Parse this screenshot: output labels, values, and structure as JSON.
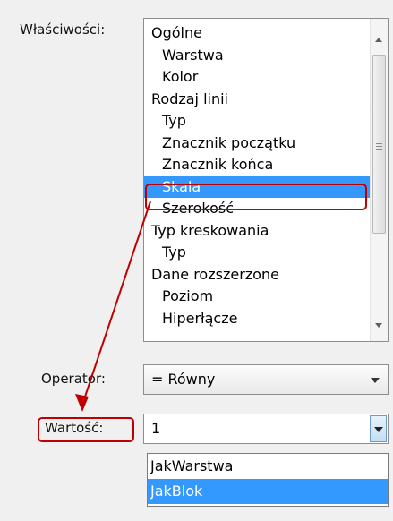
{
  "labels": {
    "properties": "Właściwości:",
    "operator": "Operator:",
    "value": "Wartość:"
  },
  "properties_list": {
    "items": [
      {
        "label": "Ogólne",
        "level": 0
      },
      {
        "label": "Warstwa",
        "level": 1
      },
      {
        "label": "Kolor",
        "level": 1
      },
      {
        "label": "Rodzaj linii",
        "level": 0
      },
      {
        "label": "Typ",
        "level": 1
      },
      {
        "label": "Znacznik początku",
        "level": 1
      },
      {
        "label": "Znacznik końca",
        "level": 1
      },
      {
        "label": "Skala",
        "level": 1,
        "selected": true
      },
      {
        "label": "Szerokość",
        "level": 1
      },
      {
        "label": "Typ kreskowania",
        "level": 0
      },
      {
        "label": "Typ",
        "level": 1
      },
      {
        "label": "Dane rozszerzone",
        "level": 0
      },
      {
        "label": "Poziom",
        "level": 1
      },
      {
        "label": "Hiperłącze",
        "level": 1
      }
    ]
  },
  "operator_combo": {
    "value": "= Równy"
  },
  "value_combo": {
    "value": "1"
  },
  "value_dropdown": {
    "options": [
      "JakWarstwa",
      "JakBlok"
    ],
    "highlighted": "JakBlok"
  },
  "icons": {
    "scroll_up": "triangle-up-icon",
    "scroll_down": "triangle-down-icon",
    "dropdown": "chevron-down-icon",
    "annotation_arrow": "arrow-icon"
  },
  "colors": {
    "selection": "#3399ff",
    "annotation": "#c00000"
  }
}
